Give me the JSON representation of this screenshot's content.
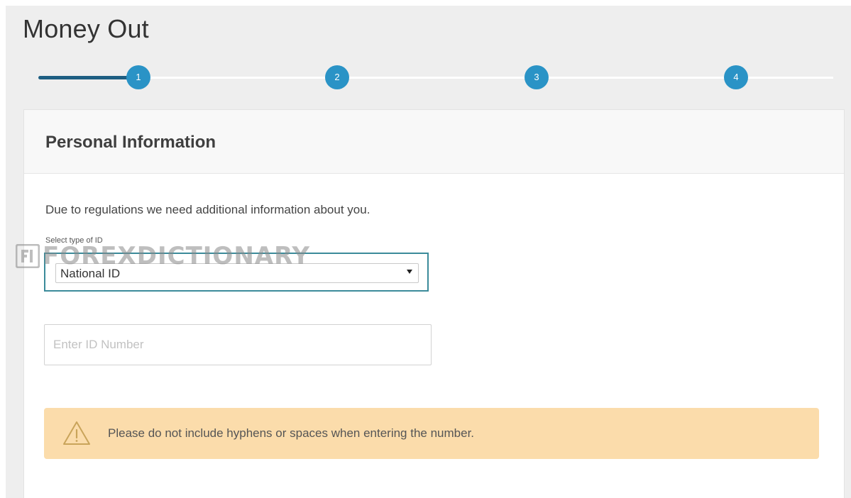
{
  "page": {
    "title": "Money Out"
  },
  "stepper": {
    "steps": [
      "1",
      "2",
      "3",
      "4"
    ],
    "current_step": 1,
    "colors": {
      "active": "#1d5e82",
      "step": "#2a93c6"
    }
  },
  "card": {
    "title": "Personal Information",
    "intro": "Due to regulations we need additional information about you.",
    "id_type": {
      "label": "Select type of ID",
      "selected": "National ID"
    },
    "id_number": {
      "placeholder": "Enter ID Number",
      "value": ""
    },
    "alert": {
      "icon": "warning-icon",
      "text": "Please do not include hyphens or spaces when entering the number.",
      "color": "#fbdcab"
    }
  },
  "watermark": {
    "text": "FOREXDICTIONARY"
  }
}
